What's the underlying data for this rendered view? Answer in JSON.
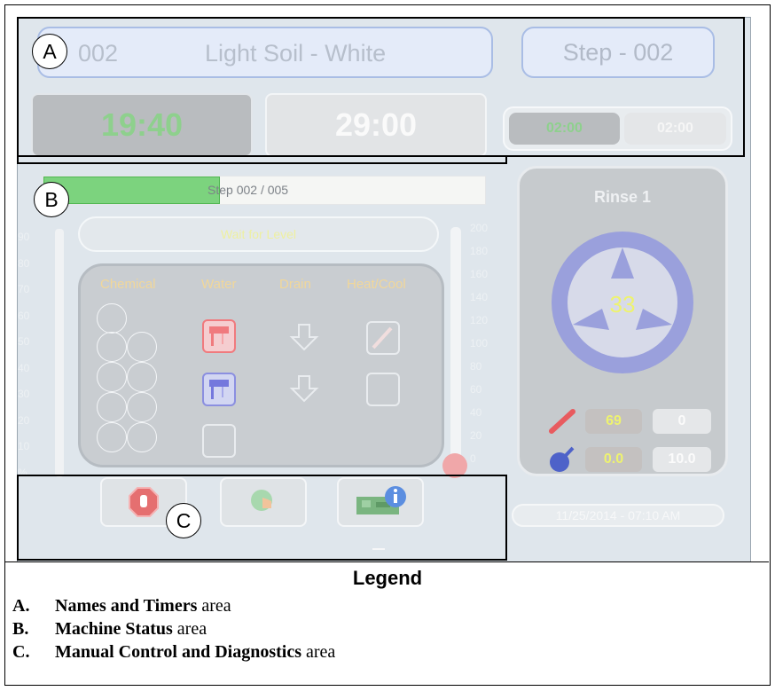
{
  "screen": {
    "recipe_number": "002",
    "recipe_name": "Light Soil - White",
    "step_name": "Step - 002",
    "timer_elapsed": "19:40",
    "timer_total": "29:00",
    "step_timer_elapsed": "02:00",
    "step_timer_total": "02:00",
    "progress_text": "Step 002 / 005",
    "progress_fraction": 0.4,
    "status_message": "Wait for Level",
    "scale_left": [
      "90",
      "80",
      "70",
      "60",
      "50",
      "40",
      "30",
      "20",
      "10",
      "%"
    ],
    "scale_right": [
      "200",
      "180",
      "160",
      "140",
      "120",
      "100",
      "80",
      "60",
      "40",
      "20",
      "0"
    ],
    "columns": [
      "Chemical",
      "Water",
      "Drain",
      "Heat/Cool"
    ],
    "operation_name": "Rinse 1",
    "operation_counter": "33",
    "temperature_value": "69",
    "temperature_target": "0",
    "level_value": "0.0",
    "level_target": "10.0",
    "datetime": "11/25/2014 - 07:10 AM",
    "icons": {
      "stop": "stop-icon",
      "manual": "hand-touch-icon",
      "diagnostics": "circuit-board-info-icon",
      "thermometer": "thermometer-icon",
      "level": "water-drop-gauge-icon"
    },
    "colors": {
      "timer_green": "#8ed08d",
      "value_yellow": "#eef36e",
      "progress_green": "#7cd37e",
      "drum_blue": "#9aa0dc"
    }
  },
  "callouts": {
    "a": "A",
    "b": "B",
    "c": "C"
  },
  "legend": {
    "title": "Legend",
    "items": [
      {
        "key": "A.",
        "bold": "Names and Timers",
        "rest": " area"
      },
      {
        "key": "B.",
        "bold": "Machine Status",
        "rest": " area"
      },
      {
        "key": "C.",
        "bold": "Manual Control and Diagnostics",
        "rest": " area"
      }
    ]
  }
}
